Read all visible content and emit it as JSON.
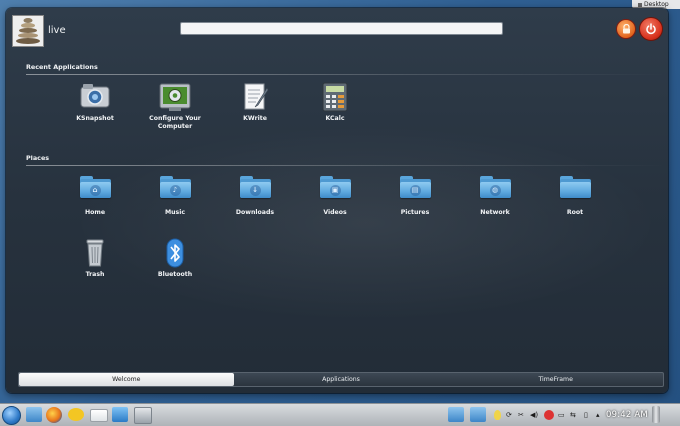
{
  "desktop_tab": {
    "label": "Desktop"
  },
  "user": {
    "name": "live"
  },
  "search": {
    "value": "",
    "placeholder": ""
  },
  "sections": {
    "recent": "Recent Applications",
    "places": "Places"
  },
  "recent_apps": [
    {
      "label": "KSnapshot",
      "icon": "ksnapshot-icon"
    },
    {
      "label": "Configure Your Computer",
      "icon": "system-settings-icon"
    },
    {
      "label": "KWrite",
      "icon": "kwrite-icon"
    },
    {
      "label": "KCalc",
      "icon": "kcalc-icon"
    }
  ],
  "places": [
    {
      "label": "Home",
      "icon": "home-folder-icon"
    },
    {
      "label": "Music",
      "icon": "music-folder-icon"
    },
    {
      "label": "Downloads",
      "icon": "downloads-folder-icon"
    },
    {
      "label": "Videos",
      "icon": "videos-folder-icon"
    },
    {
      "label": "Pictures",
      "icon": "pictures-folder-icon"
    },
    {
      "label": "Network",
      "icon": "network-folder-icon"
    },
    {
      "label": "Root",
      "icon": "root-folder-icon"
    },
    {
      "label": "Trash",
      "icon": "trash-icon"
    },
    {
      "label": "Bluetooth",
      "icon": "bluetooth-icon"
    }
  ],
  "tabs": [
    {
      "label": "Welcome",
      "active": true
    },
    {
      "label": "Applications",
      "active": false
    },
    {
      "label": "TimeFrame",
      "active": false
    }
  ],
  "taskbar": {
    "clock": "09:42 AM",
    "launchers": [
      "kickoff-icon",
      "file-manager-icon",
      "firefox-icon",
      "chat-icon",
      "mail-icon",
      "media-player-icon",
      "screenshot-icon"
    ]
  },
  "colors": {
    "panel_bg": "#27323e",
    "folder_blue": "#5fa9df",
    "power_red": "#d8321e",
    "lock_orange": "#e2641d"
  }
}
